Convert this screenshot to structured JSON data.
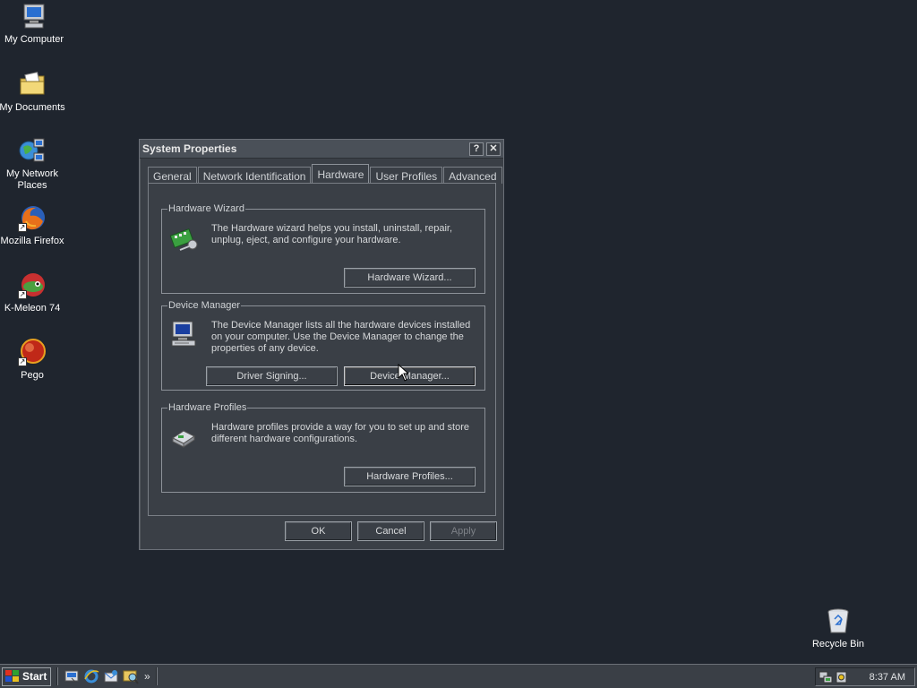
{
  "desktop": {
    "icons": [
      {
        "label": "My Computer"
      },
      {
        "label": "My Documents"
      },
      {
        "label": "My Network Places"
      },
      {
        "label": "Mozilla Firefox"
      },
      {
        "label": "K-Meleon 74"
      },
      {
        "label": "Pego"
      },
      {
        "label": "Recycle Bin"
      }
    ]
  },
  "dialog": {
    "title": "System Properties",
    "help_glyph": "?",
    "close_glyph": "✕",
    "tabs": [
      {
        "label": "General"
      },
      {
        "label": "Network Identification"
      },
      {
        "label": "Hardware",
        "active": true
      },
      {
        "label": "User Profiles"
      },
      {
        "label": "Advanced"
      }
    ],
    "hardware_wizard": {
      "legend": "Hardware Wizard",
      "description": "The Hardware wizard helps you install, uninstall, repair, unplug, eject, and configure your hardware.",
      "button": "Hardware Wizard..."
    },
    "device_manager": {
      "legend": "Device Manager",
      "description": "The Device Manager lists all the hardware devices installed on your computer. Use the Device Manager to change the properties of any device.",
      "driver_signing_button": "Driver Signing...",
      "device_manager_button": "Device Manager..."
    },
    "hardware_profiles": {
      "legend": "Hardware Profiles",
      "description": "Hardware profiles provide a way for you to set up and store different hardware configurations.",
      "button": "Hardware Profiles..."
    },
    "footer": {
      "ok": "OK",
      "cancel": "Cancel",
      "apply": "Apply"
    }
  },
  "taskbar": {
    "start_label": "Start",
    "chevron": "»",
    "clock": "8:37 AM"
  }
}
